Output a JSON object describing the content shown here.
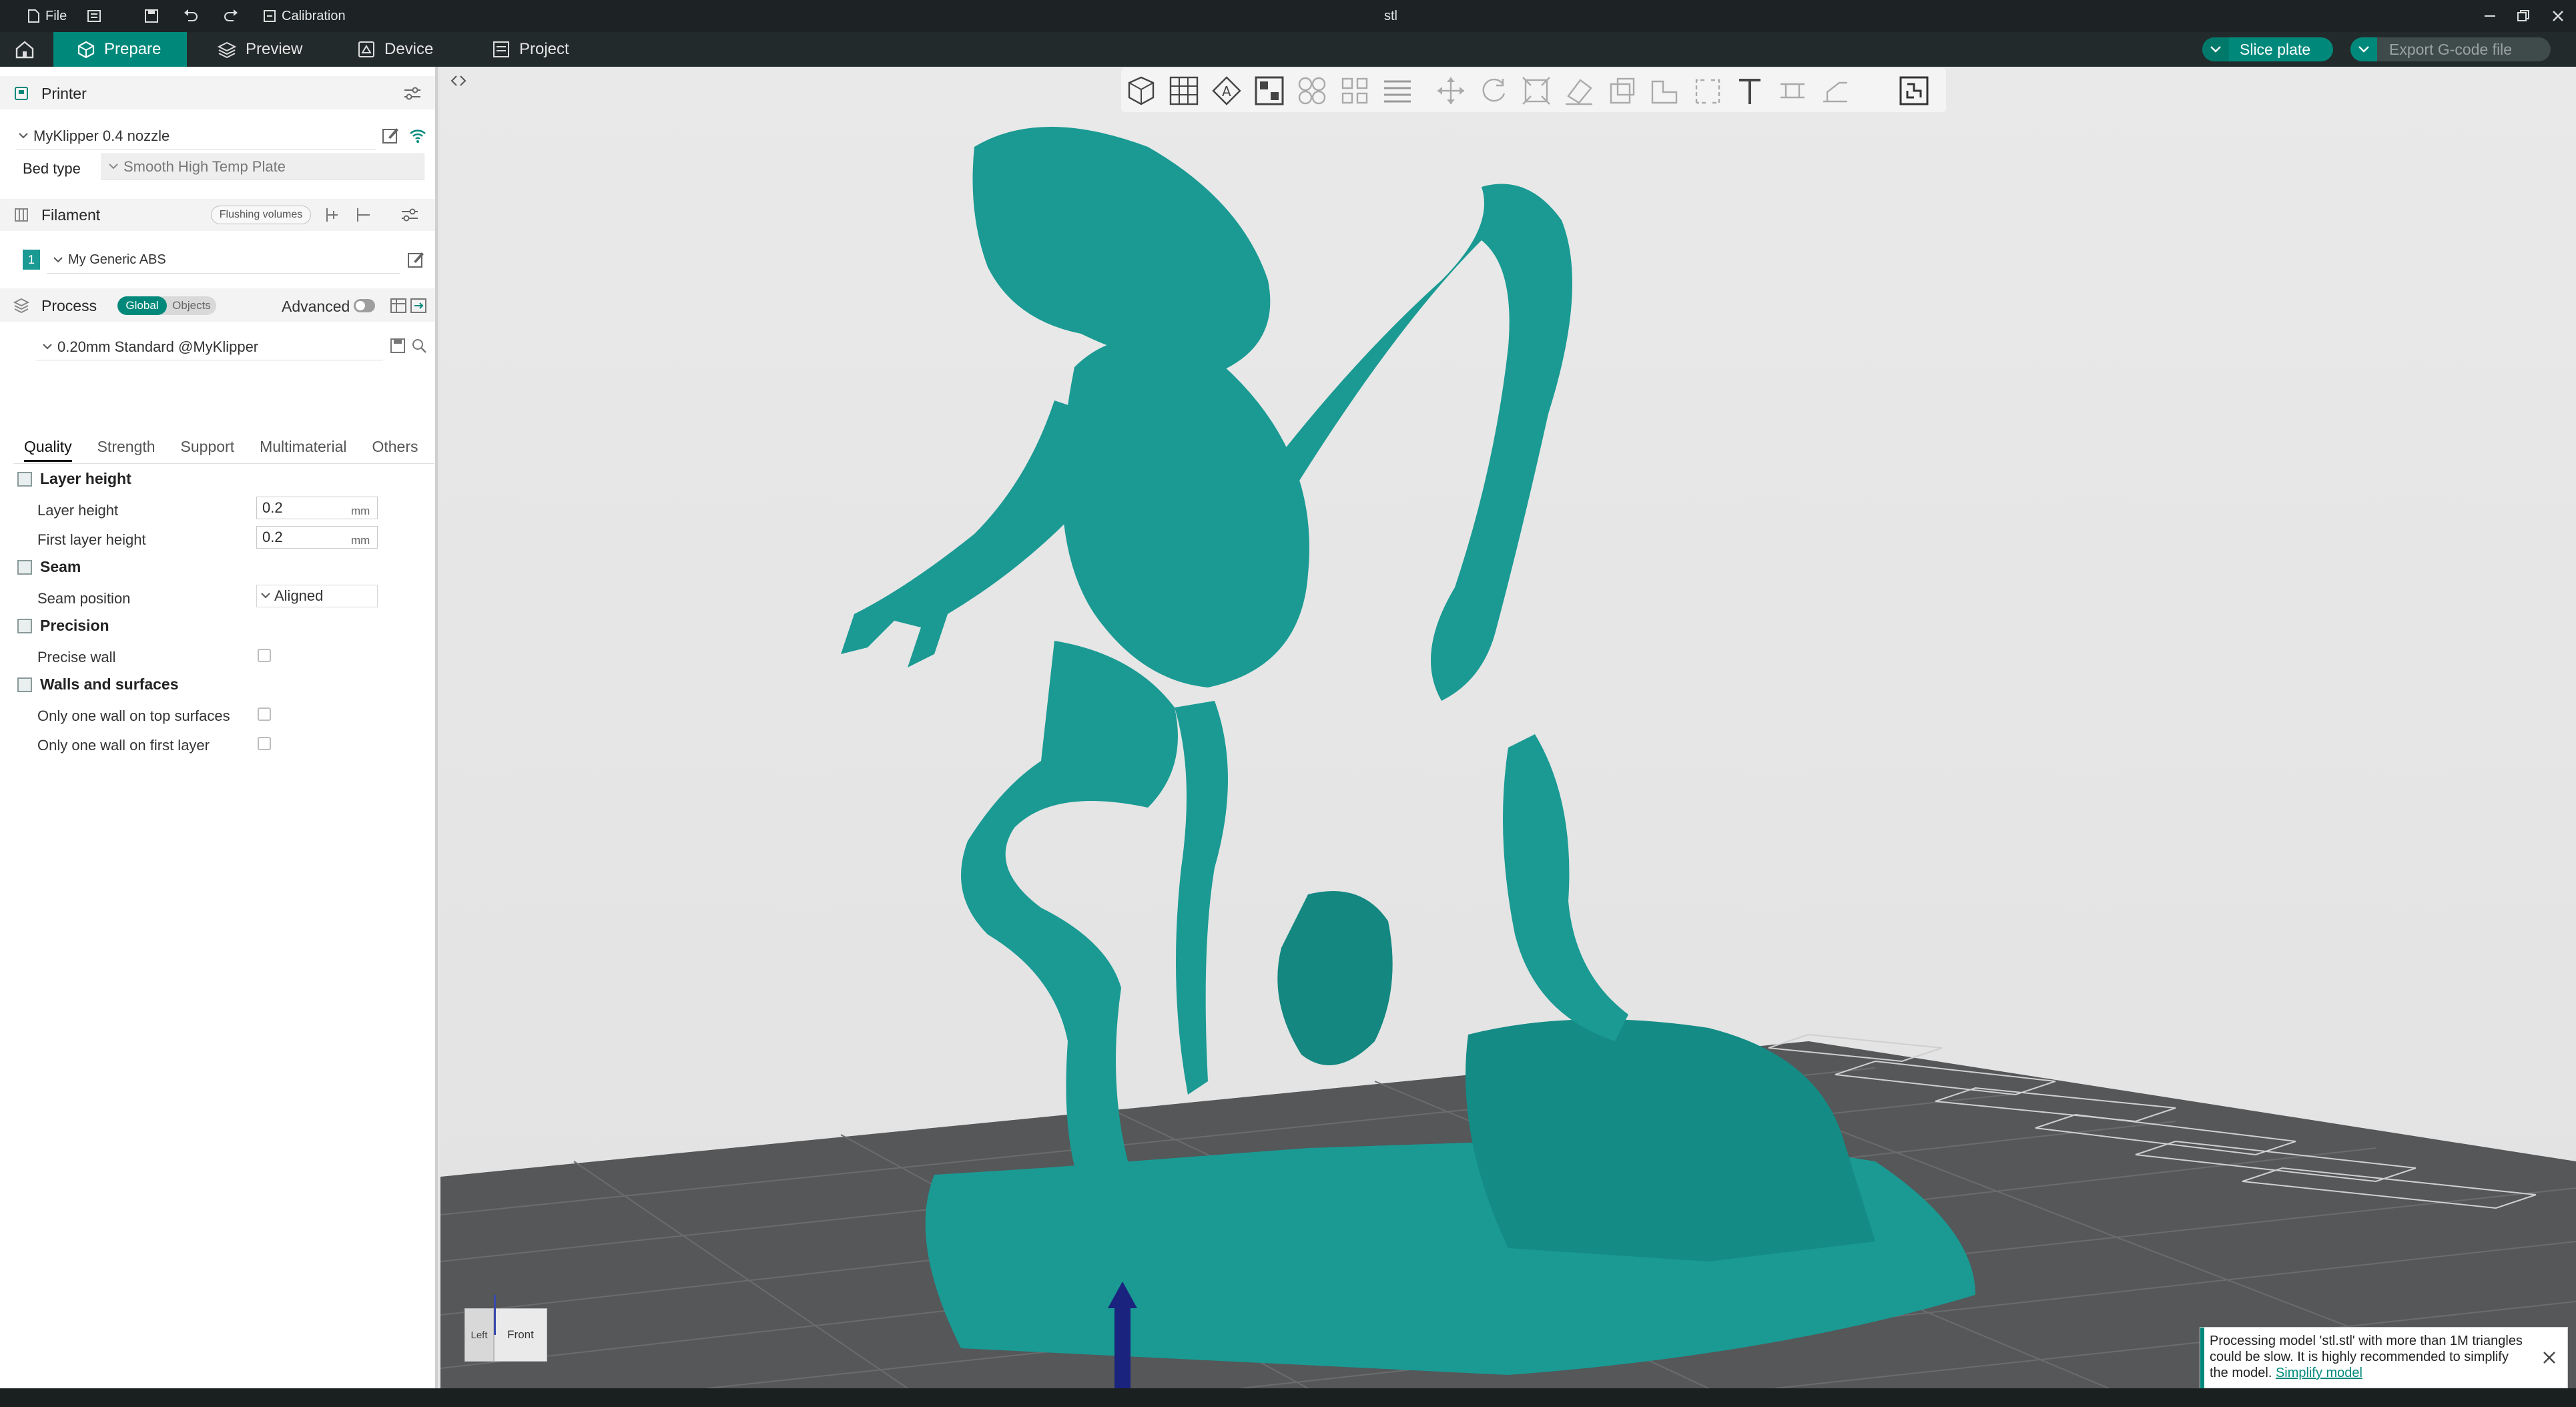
{
  "titlebar": {
    "file_label": "File",
    "calibration_label": "Calibration",
    "window_title": "stl"
  },
  "tabs": {
    "prepare": "Prepare",
    "preview": "Preview",
    "device": "Device",
    "project": "Project"
  },
  "actions": {
    "slice_plate": "Slice plate",
    "export_gcode": "Export G-code file"
  },
  "sidebar": {
    "printer": {
      "title": "Printer",
      "name": "MyKlipper 0.4 nozzle",
      "bed_type_label": "Bed type",
      "bed_type_value": "Smooth High Temp Plate"
    },
    "filament": {
      "title": "Filament",
      "flushing_volumes": "Flushing volumes",
      "items": [
        {
          "index": "1",
          "name": "My Generic ABS",
          "color": "#1a9a93"
        }
      ]
    },
    "process": {
      "title": "Process",
      "global": "Global",
      "objects": "Objects",
      "advanced": "Advanced",
      "profile": "0.20mm Standard @MyKlipper"
    },
    "quality_tabs": [
      "Quality",
      "Strength",
      "Support",
      "Multimaterial",
      "Others"
    ],
    "groups": {
      "layer_height": {
        "title": "Layer height",
        "layer_height_label": "Layer height",
        "layer_height_value": "0.2",
        "first_layer_label": "First layer height",
        "first_layer_value": "0.2",
        "unit": "mm"
      },
      "seam": {
        "title": "Seam",
        "position_label": "Seam position",
        "position_value": "Aligned"
      },
      "precision": {
        "title": "Precision",
        "precise_wall_label": "Precise wall"
      },
      "walls": {
        "title": "Walls and surfaces",
        "one_wall_top_label": "Only one wall on top surfaces",
        "one_wall_first_label": "Only one wall on first layer"
      }
    }
  },
  "viewcube": {
    "left": "Left",
    "front": "Front"
  },
  "notice": {
    "text": "Processing model 'stl.stl' with more than 1M triangles could be slow. It is highly recommended to simplify the model.",
    "link": "Simplify model"
  },
  "colors": {
    "accent": "#00897b",
    "model": "#1a9a93"
  }
}
